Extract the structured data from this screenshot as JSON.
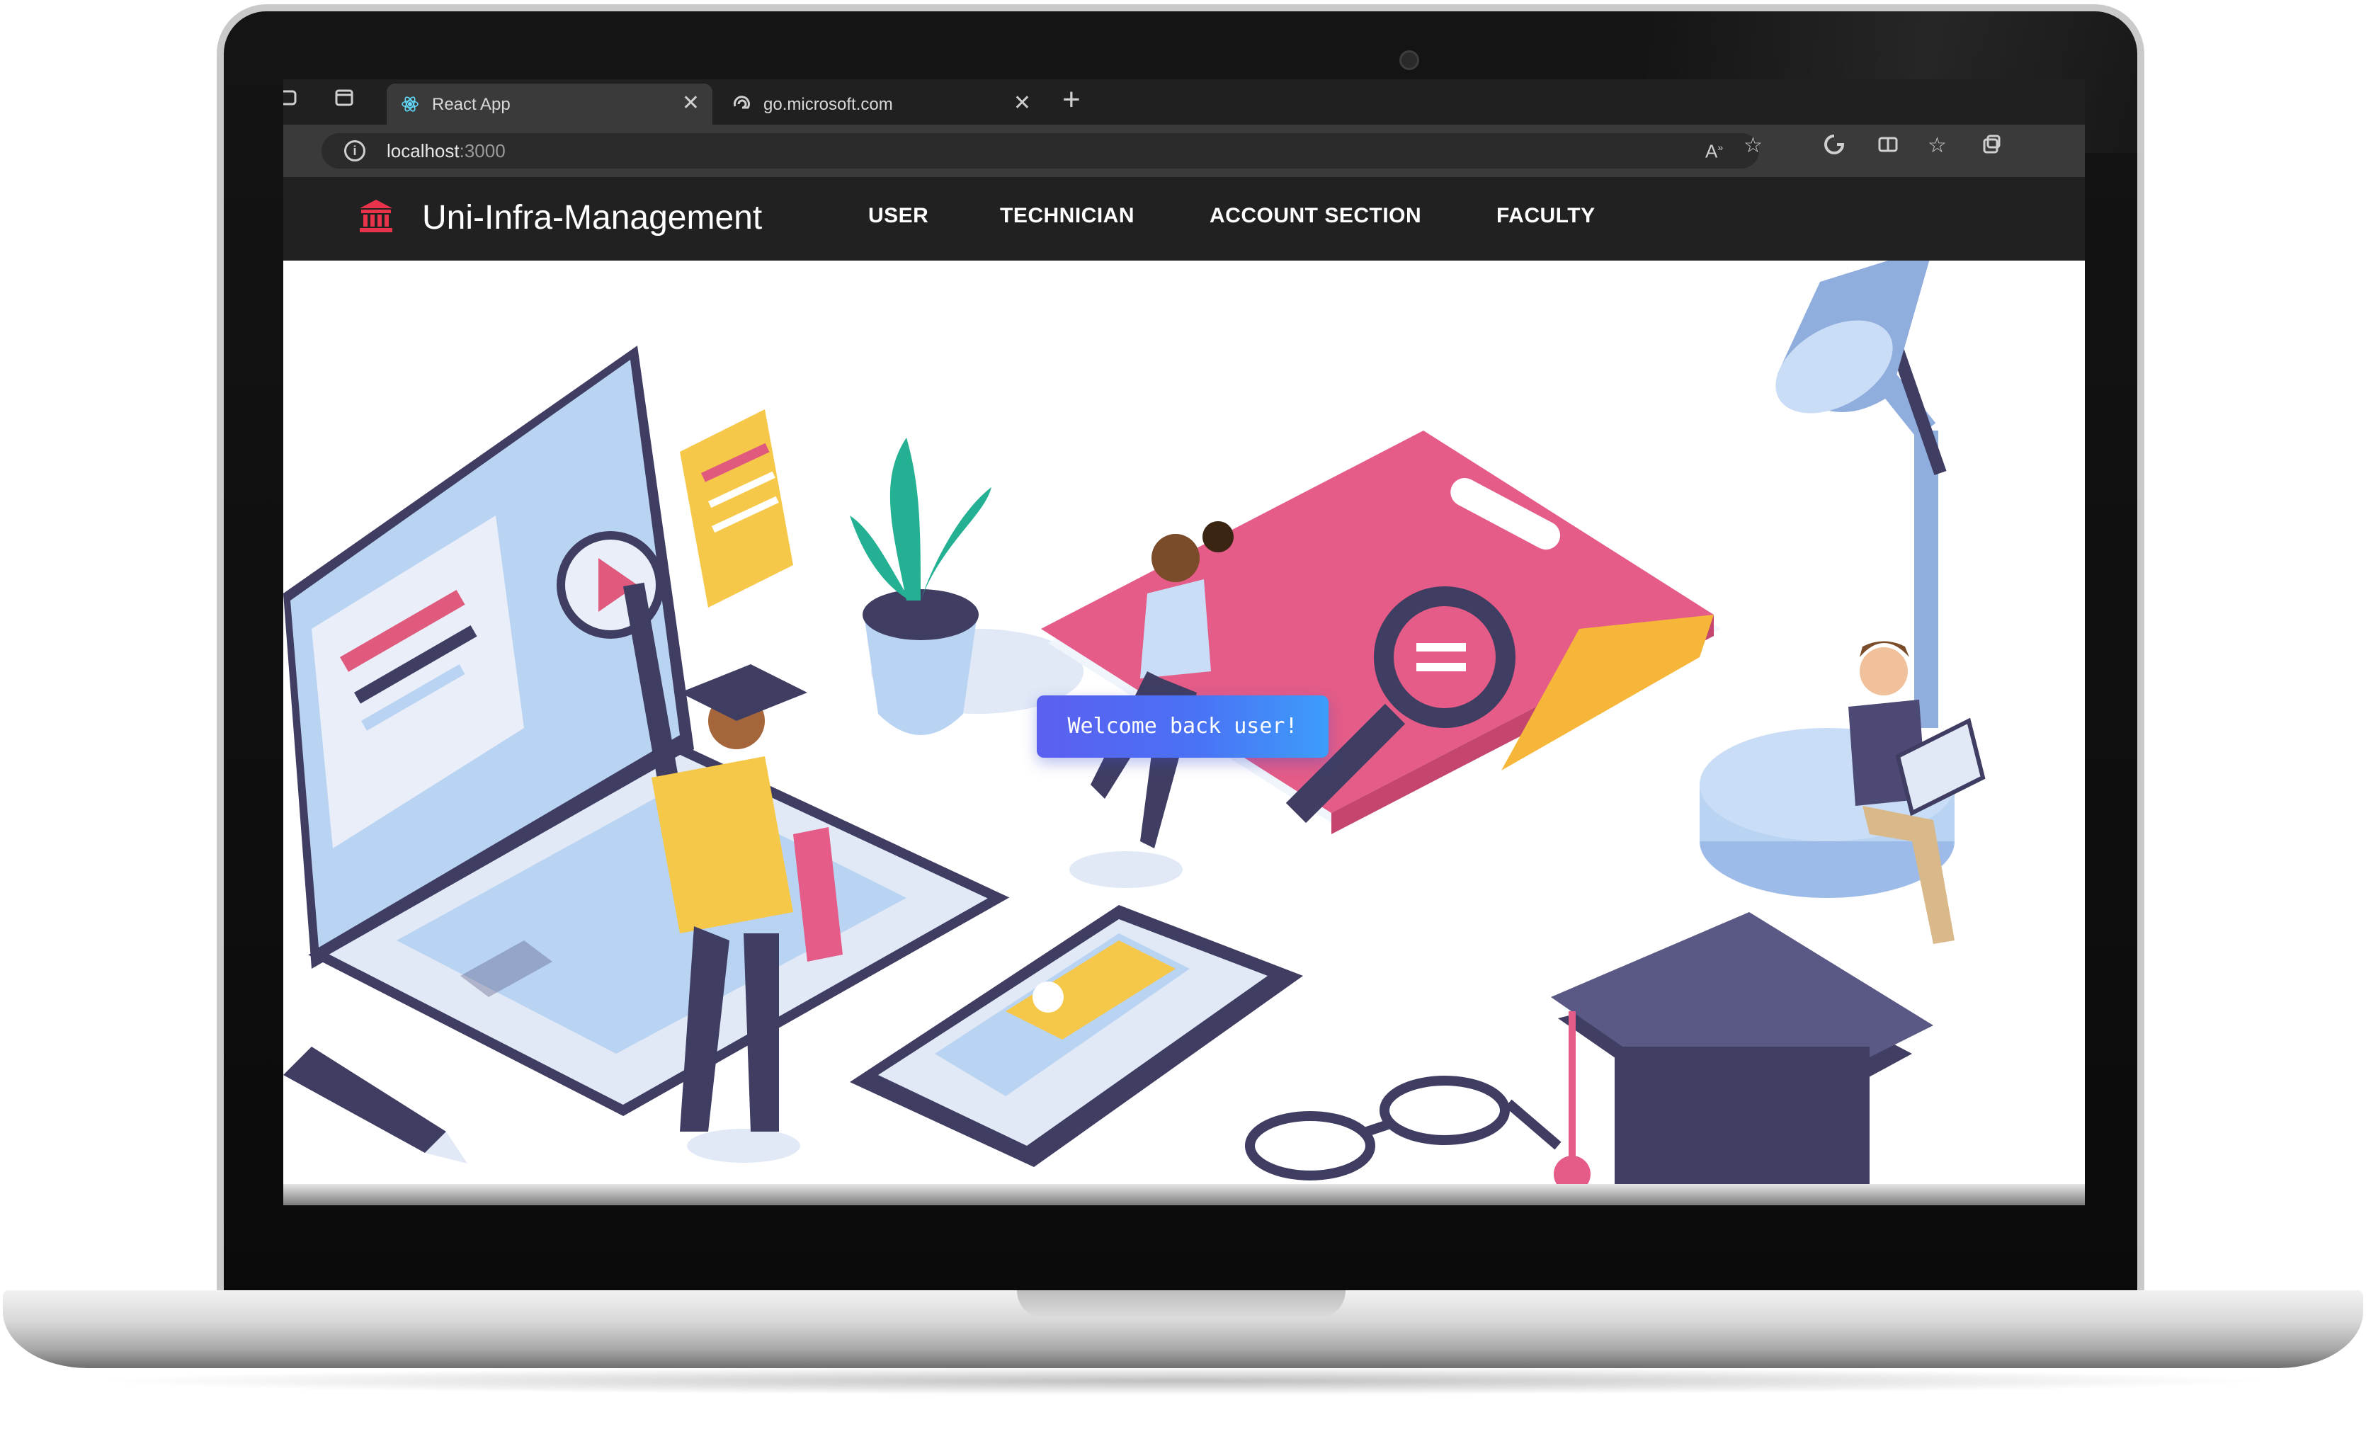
{
  "browser": {
    "tabs": [
      {
        "title": "React App",
        "active": true
      },
      {
        "title": "go.microsoft.com",
        "active": false
      }
    ],
    "address": {
      "host": "localhost",
      "port": ":3000"
    }
  },
  "navbar": {
    "brand": "Uni-Infra-Management",
    "links": [
      "USER",
      "TECHNICIAN",
      "ACCOUNT SECTION",
      "FACULTY"
    ]
  },
  "toast": {
    "message": "Welcome back user!"
  },
  "colors": {
    "brand_icon": "#e8334a",
    "toast_start": "#5b5ff0",
    "toast_end": "#3d9dfa",
    "navbar_bg": "#212121"
  },
  "icons": [
    "tab-actions-icon",
    "workspaces-icon",
    "react-favicon",
    "edge-favicon",
    "close-icon",
    "new-tab-icon",
    "info-icon",
    "read-aloud-icon",
    "favorite-star-icon",
    "copilot-icon",
    "split-screen-icon",
    "favorites-icon",
    "collections-icon",
    "university-building-icon"
  ]
}
